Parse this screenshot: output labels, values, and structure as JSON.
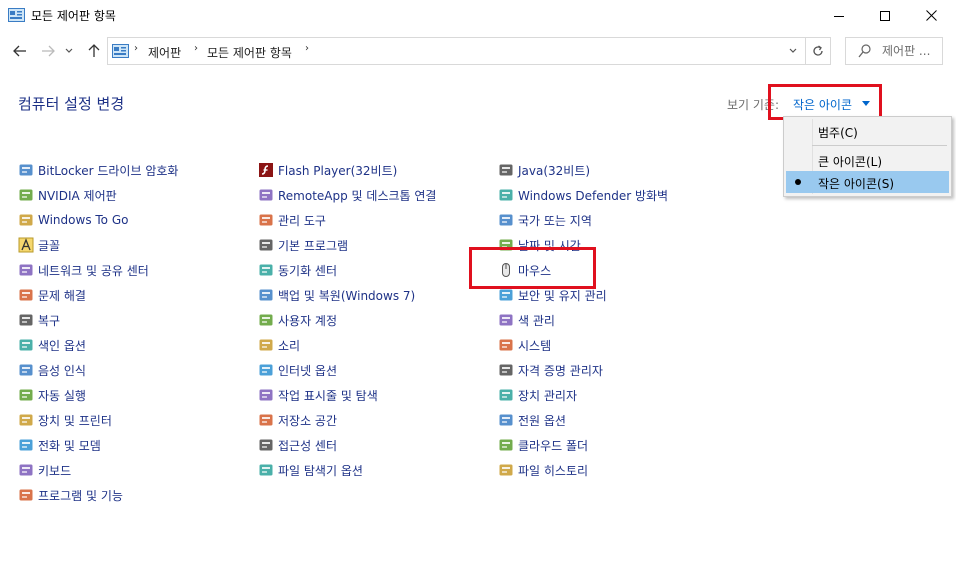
{
  "window": {
    "title": "모든 제어판 항목",
    "minimize_icon": "minimize-icon",
    "maximize_icon": "maximize-icon",
    "close_icon": "close-icon"
  },
  "navigation": {
    "breadcrumbs": [
      "제어판",
      "모든 제어판 항목"
    ],
    "search_placeholder": "제어판 ..."
  },
  "heading": "컴퓨터 설정 변경",
  "view_by": {
    "label": "보기 기준:",
    "value": "작은 아이콘",
    "options": [
      {
        "label": "범주(C)",
        "selected": false
      },
      {
        "label": "큰 아이콘(L)",
        "selected": false
      },
      {
        "label": "작은 아이콘(S)",
        "selected": true
      }
    ]
  },
  "items": {
    "col1": [
      "BitLocker 드라이브 암호화",
      "NVIDIA 제어판",
      "Windows To Go",
      "글꼴",
      "네트워크 및 공유 센터",
      "문제 해결",
      "복구",
      "색인 옵션",
      "음성 인식",
      "자동 실행",
      "장치 및 프린터",
      "전화 및 모뎀",
      "키보드",
      "프로그램 및 기능"
    ],
    "col2": [
      "Flash Player(32비트)",
      "RemoteApp 및 데스크톱 연결",
      "관리 도구",
      "기본 프로그램",
      "동기화 센터",
      "백업 및 복원(Windows 7)",
      "사용자 계정",
      "소리",
      "인터넷 옵션",
      "작업 표시줄 및 탐색",
      "저장소 공간",
      "접근성 센터",
      "파일 탐색기 옵션"
    ],
    "col3": [
      "Java(32비트)",
      "Windows Defender 방화벽",
      "국가 또는 지역",
      "날짜 및 시간",
      "마우스",
      "보안 및 유지 관리",
      "색 관리",
      "시스템",
      "자격 증명 관리자",
      "장치 관리자",
      "전원 옵션",
      "클라우드 폴더",
      "파일 히스토리"
    ]
  },
  "colors": {
    "link": "#1e3287",
    "accent": "#0066cc",
    "highlight_border": "#e0101e",
    "menu_selected": "#99c9ef"
  }
}
